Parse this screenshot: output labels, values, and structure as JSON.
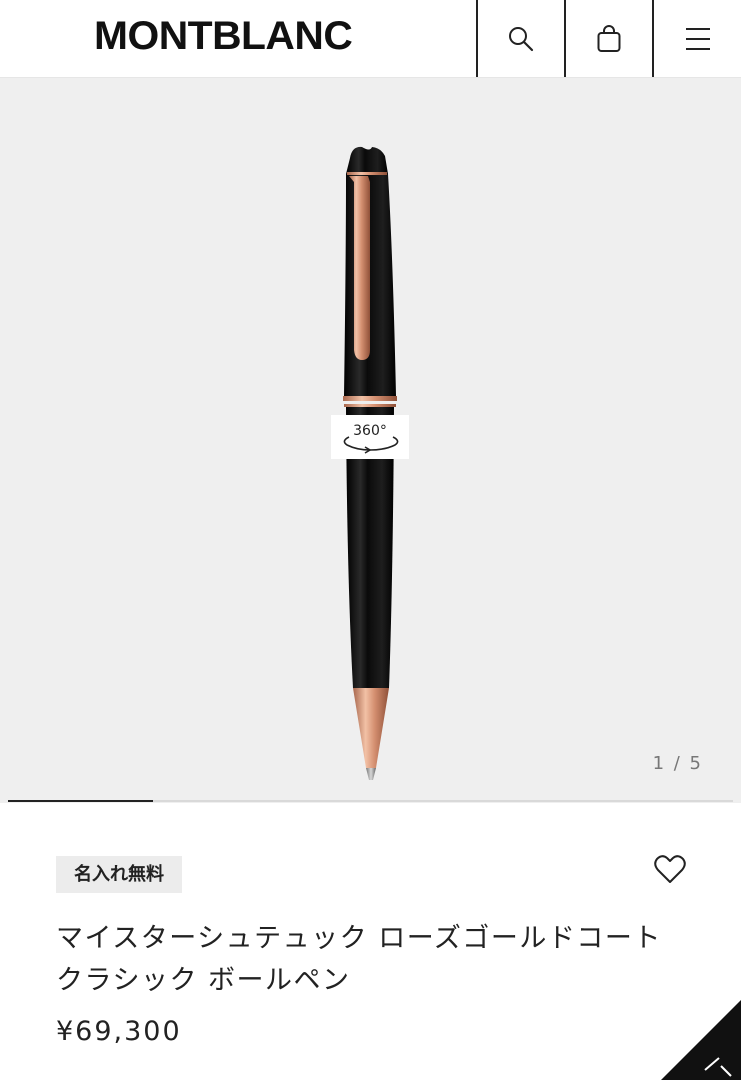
{
  "header": {
    "logo": "MONTBLANC",
    "search_icon": "search-icon",
    "bag_icon": "shopping-bag-icon",
    "menu_icon": "hamburger-menu-icon"
  },
  "gallery": {
    "badge_360": "360°",
    "counter": "1 / 5",
    "current_slide": 1,
    "total_slides": 5,
    "progress_fraction": 0.2
  },
  "product": {
    "tag": "名入れ無料",
    "title": "マイスターシュテュック ローズゴールドコート クラシック ボールペン",
    "price": "¥69,300",
    "wishlist_icon": "heart-icon"
  },
  "colors": {
    "background": "#efefef",
    "pen_body": "#0d0d0d",
    "rose_gold": "#d9987a",
    "text": "#222222"
  }
}
